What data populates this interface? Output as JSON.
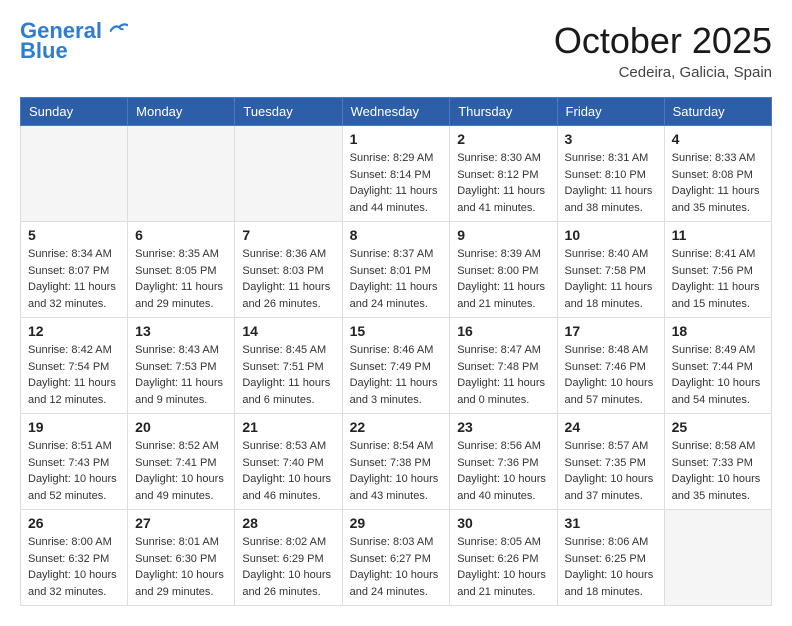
{
  "header": {
    "logo_line1": "General",
    "logo_line2": "Blue",
    "month": "October 2025",
    "location": "Cedeira, Galicia, Spain"
  },
  "weekdays": [
    "Sunday",
    "Monday",
    "Tuesday",
    "Wednesday",
    "Thursday",
    "Friday",
    "Saturday"
  ],
  "weeks": [
    [
      {
        "num": "",
        "info": ""
      },
      {
        "num": "",
        "info": ""
      },
      {
        "num": "",
        "info": ""
      },
      {
        "num": "1",
        "info": "Sunrise: 8:29 AM\nSunset: 8:14 PM\nDaylight: 11 hours and 44 minutes."
      },
      {
        "num": "2",
        "info": "Sunrise: 8:30 AM\nSunset: 8:12 PM\nDaylight: 11 hours and 41 minutes."
      },
      {
        "num": "3",
        "info": "Sunrise: 8:31 AM\nSunset: 8:10 PM\nDaylight: 11 hours and 38 minutes."
      },
      {
        "num": "4",
        "info": "Sunrise: 8:33 AM\nSunset: 8:08 PM\nDaylight: 11 hours and 35 minutes."
      }
    ],
    [
      {
        "num": "5",
        "info": "Sunrise: 8:34 AM\nSunset: 8:07 PM\nDaylight: 11 hours and 32 minutes."
      },
      {
        "num": "6",
        "info": "Sunrise: 8:35 AM\nSunset: 8:05 PM\nDaylight: 11 hours and 29 minutes."
      },
      {
        "num": "7",
        "info": "Sunrise: 8:36 AM\nSunset: 8:03 PM\nDaylight: 11 hours and 26 minutes."
      },
      {
        "num": "8",
        "info": "Sunrise: 8:37 AM\nSunset: 8:01 PM\nDaylight: 11 hours and 24 minutes."
      },
      {
        "num": "9",
        "info": "Sunrise: 8:39 AM\nSunset: 8:00 PM\nDaylight: 11 hours and 21 minutes."
      },
      {
        "num": "10",
        "info": "Sunrise: 8:40 AM\nSunset: 7:58 PM\nDaylight: 11 hours and 18 minutes."
      },
      {
        "num": "11",
        "info": "Sunrise: 8:41 AM\nSunset: 7:56 PM\nDaylight: 11 hours and 15 minutes."
      }
    ],
    [
      {
        "num": "12",
        "info": "Sunrise: 8:42 AM\nSunset: 7:54 PM\nDaylight: 11 hours and 12 minutes."
      },
      {
        "num": "13",
        "info": "Sunrise: 8:43 AM\nSunset: 7:53 PM\nDaylight: 11 hours and 9 minutes."
      },
      {
        "num": "14",
        "info": "Sunrise: 8:45 AM\nSunset: 7:51 PM\nDaylight: 11 hours and 6 minutes."
      },
      {
        "num": "15",
        "info": "Sunrise: 8:46 AM\nSunset: 7:49 PM\nDaylight: 11 hours and 3 minutes."
      },
      {
        "num": "16",
        "info": "Sunrise: 8:47 AM\nSunset: 7:48 PM\nDaylight: 11 hours and 0 minutes."
      },
      {
        "num": "17",
        "info": "Sunrise: 8:48 AM\nSunset: 7:46 PM\nDaylight: 10 hours and 57 minutes."
      },
      {
        "num": "18",
        "info": "Sunrise: 8:49 AM\nSunset: 7:44 PM\nDaylight: 10 hours and 54 minutes."
      }
    ],
    [
      {
        "num": "19",
        "info": "Sunrise: 8:51 AM\nSunset: 7:43 PM\nDaylight: 10 hours and 52 minutes."
      },
      {
        "num": "20",
        "info": "Sunrise: 8:52 AM\nSunset: 7:41 PM\nDaylight: 10 hours and 49 minutes."
      },
      {
        "num": "21",
        "info": "Sunrise: 8:53 AM\nSunset: 7:40 PM\nDaylight: 10 hours and 46 minutes."
      },
      {
        "num": "22",
        "info": "Sunrise: 8:54 AM\nSunset: 7:38 PM\nDaylight: 10 hours and 43 minutes."
      },
      {
        "num": "23",
        "info": "Sunrise: 8:56 AM\nSunset: 7:36 PM\nDaylight: 10 hours and 40 minutes."
      },
      {
        "num": "24",
        "info": "Sunrise: 8:57 AM\nSunset: 7:35 PM\nDaylight: 10 hours and 37 minutes."
      },
      {
        "num": "25",
        "info": "Sunrise: 8:58 AM\nSunset: 7:33 PM\nDaylight: 10 hours and 35 minutes."
      }
    ],
    [
      {
        "num": "26",
        "info": "Sunrise: 8:00 AM\nSunset: 6:32 PM\nDaylight: 10 hours and 32 minutes."
      },
      {
        "num": "27",
        "info": "Sunrise: 8:01 AM\nSunset: 6:30 PM\nDaylight: 10 hours and 29 minutes."
      },
      {
        "num": "28",
        "info": "Sunrise: 8:02 AM\nSunset: 6:29 PM\nDaylight: 10 hours and 26 minutes."
      },
      {
        "num": "29",
        "info": "Sunrise: 8:03 AM\nSunset: 6:27 PM\nDaylight: 10 hours and 24 minutes."
      },
      {
        "num": "30",
        "info": "Sunrise: 8:05 AM\nSunset: 6:26 PM\nDaylight: 10 hours and 21 minutes."
      },
      {
        "num": "31",
        "info": "Sunrise: 8:06 AM\nSunset: 6:25 PM\nDaylight: 10 hours and 18 minutes."
      },
      {
        "num": "",
        "info": ""
      }
    ]
  ]
}
